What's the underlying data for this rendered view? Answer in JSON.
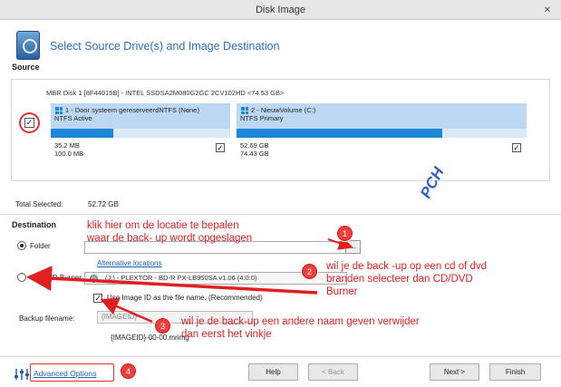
{
  "window": {
    "title": "Disk Image"
  },
  "header": {
    "title": "Select Source Drive(s) and Image Destination"
  },
  "source": {
    "label": "Source",
    "disk_header": "MBR Disk 1 [8F44015B] - INTEL SSDSA2M080G2GC 2CV102HD  <74.53 GB>",
    "partitions": [
      {
        "title": "1 - Door systeem gereserveerdNTFS (None)",
        "sub": "NTFS Active",
        "used": "35.2 MB",
        "total": "100.0 MB",
        "fill_fraction": 0.35
      },
      {
        "title": "2 - NieuwVolume (C:)",
        "sub": "NTFS Primary",
        "used": "52.69 GB",
        "total": "74.43 GB",
        "fill_fraction": 0.71
      }
    ],
    "total_label": "Total Selected:",
    "total_value": "52.72 GB"
  },
  "destination": {
    "label": "Destination",
    "folder_label": "Folder",
    "folder_value": "",
    "browse_label": "...",
    "alt_locations": "Alternative locations",
    "cd_label": "CD/DVD Burner",
    "burner_value": "(J:) - PLEXTOR - BD-R  PX-LB950SA v1.06 (4:0:0)",
    "imageid_text": "Use Image ID as the file name.  (Recommended)",
    "backup_filename_label": "Backup filename:",
    "backup_filename_placeholder": "{IMAGEID}",
    "filename_preview": "{IMAGEID}-00-00.mrimg"
  },
  "footer": {
    "advanced": "Advanced Options",
    "help": "Help",
    "back": "< Back",
    "next": "Next >",
    "finish": "Finish"
  },
  "annotations": {
    "badges": [
      "1",
      "2",
      "3",
      "4"
    ],
    "note1": [
      "klik hier om de locatie te bepalen",
      "waar de back- up wordt opgeslagen"
    ],
    "note2": [
      "wil je de back -up op een cd of dvd",
      "branden selecteer dan CD/DVD",
      "Burner"
    ],
    "note3": [
      "wil je de back-up een andere naam  geven verwijder",
      "dan eerst het vinkje"
    ],
    "watermark": "PCH",
    "accent_color": "#e02020"
  }
}
